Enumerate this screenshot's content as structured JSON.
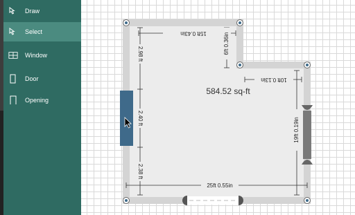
{
  "sidebar": {
    "items": [
      {
        "label": "Draw",
        "icon": "pencil-icon"
      },
      {
        "label": "Select",
        "icon": "cursor-icon"
      },
      {
        "label": "Window",
        "icon": "window-icon"
      },
      {
        "label": "Door",
        "icon": "door-icon"
      },
      {
        "label": "Opening",
        "icon": "opening-icon"
      }
    ],
    "active": "Select"
  },
  "floorplan": {
    "area": "584.52 sq-ft",
    "dimensions": {
      "top": "15ft 0.43in",
      "notch_vertical": "6ft 0.36in",
      "notch_horizontal": "10ft 0.13in",
      "right": "19ft 0.19in",
      "bottom": "25ft 0.55in",
      "left_upper": "2.98 ft",
      "left_window": "2.40 ft",
      "left_lower": "2.38 ft"
    }
  },
  "colors": {
    "sidebar": "#2f6b62",
    "sidebar_active": "#4b8b80",
    "wall": "#d4d4d4",
    "floor": "#ececec",
    "window_selected": "#3f6a8a",
    "window": "#7a7a7a"
  }
}
